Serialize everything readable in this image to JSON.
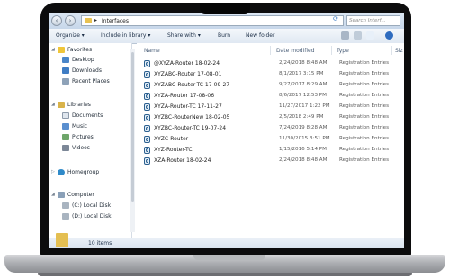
{
  "window": {
    "path": "Interfaces",
    "search_placeholder": "Search Interf..."
  },
  "toolbar": {
    "organize": "Organize ▾",
    "include": "Include in library ▾",
    "share": "Share with ▾",
    "burn": "Burn",
    "new_folder": "New folder"
  },
  "nav": {
    "favorites": "Favorites",
    "desktop": "Desktop",
    "downloads": "Downloads",
    "recent": "Recent Places",
    "libraries": "Libraries",
    "documents": "Documents",
    "music": "Music",
    "pictures": "Pictures",
    "videos": "Videos",
    "homegroup": "Homegroup",
    "computer": "Computer",
    "local_c": "(C:) Local Disk",
    "local_d": "(D:) Local Disk"
  },
  "columns": {
    "name": "Name",
    "date": "Date modified",
    "type": "Type",
    "size": "Siz"
  },
  "files": [
    {
      "name": "@XYZA-Router 18-02-24",
      "date": "2/24/2018 8:48 AM",
      "type": "Registration Entries"
    },
    {
      "name": "XYZABC-Router 17-08-01",
      "date": "8/1/2017 3:15 PM",
      "type": "Registration Entries"
    },
    {
      "name": "XYZABC-Router-TC 17-09-27",
      "date": "9/27/2017 8:29 AM",
      "type": "Registration Entries"
    },
    {
      "name": "XYZA-Router 17-08-06",
      "date": "8/6/2017 12:53 PM",
      "type": "Registration Entries"
    },
    {
      "name": "XYZA-Router-TC 17-11-27",
      "date": "11/27/2017 1:22 PM",
      "type": "Registration Entries"
    },
    {
      "name": "XYZBC-RouterNew 18-02-05",
      "date": "2/5/2018 2:49 PM",
      "type": "Registration Entries"
    },
    {
      "name": "XYZBC-Router-TC 19-07-24",
      "date": "7/24/2019 8:28 AM",
      "type": "Registration Entries"
    },
    {
      "name": "XYZC-Router",
      "date": "11/30/2015 3:51 PM",
      "type": "Registration Entries"
    },
    {
      "name": "XYZ-Router-TC",
      "date": "1/15/2016 5:14 PM",
      "type": "Registration Entries"
    },
    {
      "name": "XZA-Router 18-02-24",
      "date": "2/24/2018 8:48 AM",
      "type": "Registration Entries"
    }
  ],
  "status": {
    "count": "10 items"
  }
}
